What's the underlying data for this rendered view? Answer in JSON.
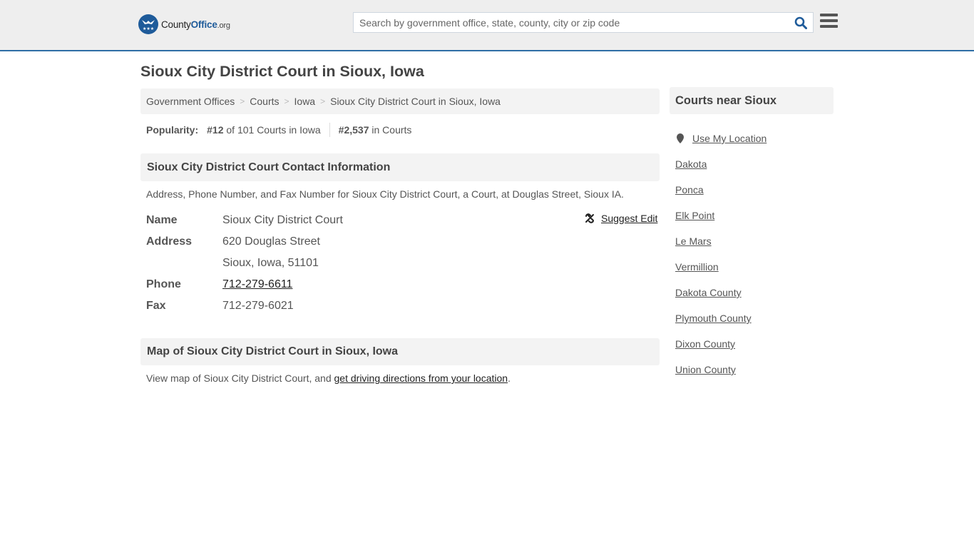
{
  "header": {
    "logo": {
      "county": "County",
      "office": "Office",
      "tld": ".org"
    },
    "search_placeholder": "Search by government office, state, county, city or zip code",
    "search_icon": "search-icon",
    "menu_icon": "hamburger-menu-icon"
  },
  "page_title": "Sioux City District Court in Sioux, Iowa",
  "breadcrumb": [
    {
      "label": "Government Offices"
    },
    {
      "label": "Courts"
    },
    {
      "label": "Iowa"
    },
    {
      "label": "Sioux City District Court in Sioux, Iowa"
    }
  ],
  "breadcrumb_separator": ">",
  "popularity": {
    "label": "Popularity:",
    "state_rank": "#12",
    "state_rank_text": "of 101 Courts in Iowa",
    "national_rank": "#2,537",
    "national_rank_text": "in Courts"
  },
  "contact": {
    "heading": "Sioux City District Court Contact Information",
    "description": "Address, Phone Number, and Fax Number for Sioux City District Court, a Court, at Douglas Street, Sioux IA.",
    "suggest_edit": "Suggest Edit",
    "fields": {
      "name_label": "Name",
      "name": "Sioux City District Court",
      "address_label": "Address",
      "address_line1": "620 Douglas Street",
      "address_line2": "Sioux, Iowa, 51101",
      "phone_label": "Phone",
      "phone": "712-279-6611",
      "fax_label": "Fax",
      "fax": "712-279-6021"
    }
  },
  "map": {
    "heading": "Map of Sioux City District Court in Sioux, Iowa",
    "text_prefix": "View map of Sioux City District Court, and ",
    "link": "get driving directions from your location",
    "text_suffix": "."
  },
  "sidebar": {
    "heading": "Courts near Sioux",
    "use_location": "Use My Location",
    "items": [
      "Dakota",
      "Ponca",
      "Elk Point",
      "Le Mars",
      "Vermillion",
      "Dakota County",
      "Plymouth County",
      "Dixon County",
      "Union County"
    ]
  },
  "colors": {
    "brand": "#1e5b9a",
    "header_border": "#2f6ea6",
    "panel_bg": "#f3f3f3"
  }
}
